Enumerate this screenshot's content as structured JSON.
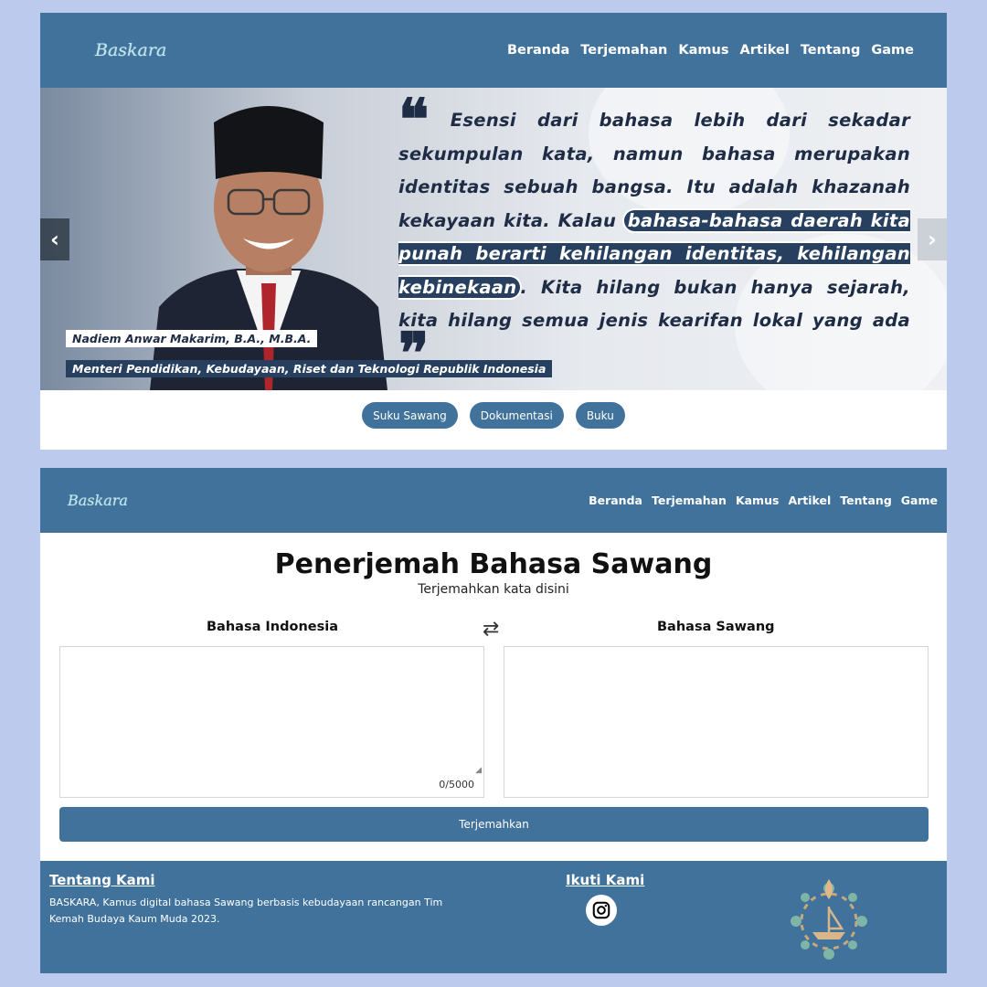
{
  "nav": {
    "logo": "Baskara",
    "items": [
      "Beranda",
      "Terjemahan",
      "Kamus",
      "Artikel",
      "Tentang",
      "Game"
    ]
  },
  "hero": {
    "quote_open": "❝",
    "quote_part1": "Esensi dari bahasa lebih dari sekadar sekumpulan kata, namun bahasa merupakan identitas sebuah bangsa. Itu adalah khazanah  kekayaan kita. Kalau ",
    "quote_highlight": "bahasa-bahasa daerah kita punah berarti kehilangan identitas, kehilangan kebinekaan",
    "quote_part2": ". Kita hilang bukan hanya sejarah, kita hilang semua jenis kearifan lokal yang ada",
    "quote_close": "❞",
    "caption_name": "Nadiem Anwar Makarim, B.A., M.B.A.",
    "caption_role": "Menteri Pendidikan, Kebudayaan, Riset dan Teknologi Republik Indonesia",
    "prev": "‹",
    "next": "›"
  },
  "pills": [
    "Suku Sawang",
    "Dokumentasi",
    "Buku"
  ],
  "translator": {
    "title": "Penerjemah Bahasa Sawang",
    "subtitle": "Terjemahkan kata disini",
    "source_lang": "Bahasa Indonesia",
    "target_lang": "Bahasa Sawang",
    "swap_icon": "⇄",
    "counter": "0/5000",
    "button": "Terjemahkan"
  },
  "footer": {
    "about_title": "Tentang Kami",
    "about_text": "BASKARA, Kamus digital bahasa Sawang berbasis kebudayaan rancangan Tim Kemah Budaya Kaum Muda 2023.",
    "follow_title": "Ikuti Kami"
  },
  "colors": {
    "page_bg": "#bccbed",
    "primary": "#41729b",
    "dark_navy": "#27405f"
  }
}
